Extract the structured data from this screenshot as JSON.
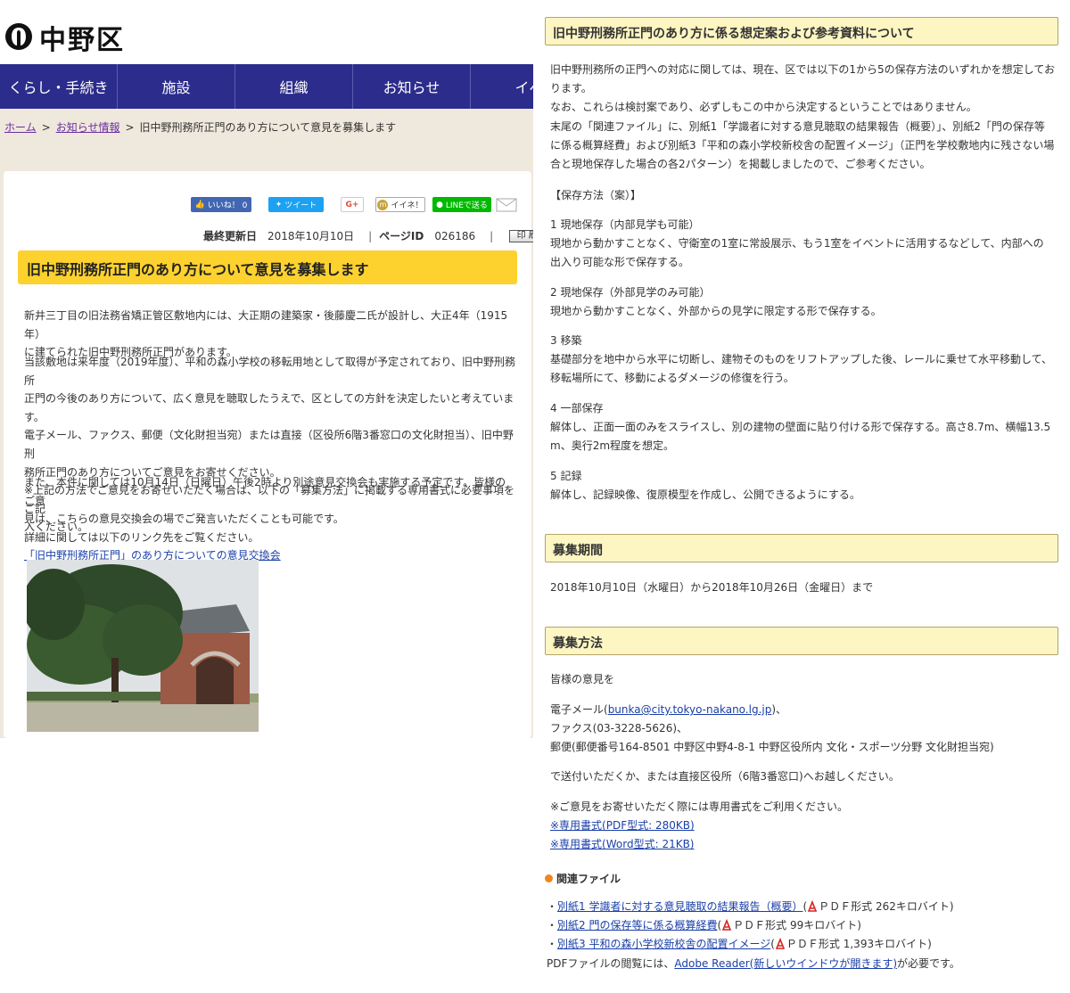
{
  "header": {
    "logo_text": "中野区"
  },
  "nav": [
    "くらし・手続き",
    "施設",
    "組織",
    "お知らせ",
    "イベ"
  ],
  "breadcrumb": {
    "home": "ホーム",
    "sep": ">",
    "news": "お知らせ情報",
    "current": "旧中野刑務所正門のあり方について意見を募集します"
  },
  "share": {
    "like": "いいね！ 0",
    "tweet": "ツイート",
    "gplus": "G+",
    "iine": "イイネ！",
    "line": "LINEで送る"
  },
  "meta": {
    "updated_label": "最終更新日",
    "updated_value": "2018年10月10日",
    "sep": "|",
    "page_id_label": "ページID",
    "page_id_value": "026186",
    "print": "印 刷"
  },
  "article": {
    "title": "旧中野刑務所正門のあり方について意見を募集します",
    "p1": [
      "新井三丁目の旧法務省矯正管区敷地内には、大正期の建築家・後藤慶二氏が設計し、大正4年（1915年）",
      "に建てられた旧中野刑務所正門があります。"
    ],
    "p2": [
      "当該敷地は来年度（2019年度）、平和の森小学校の移転用地として取得が予定されており、旧中野刑務所",
      "正門の今後のあり方について、広く意見を聴取したうえで、区としての方針を決定したいと考えています。",
      "電子メール、ファクス、郵便（文化財担当宛）または直接（区役所6階3番窓口の文化財担当）、旧中野刑",
      "務所正門のあり方についてご意見をお寄せください。",
      "※上記の方法でご意見をお寄せいただく場合は、以下の「募集方法」に掲載する専用書式に必要事項をご記",
      "入ください。"
    ],
    "p3": [
      "また、本件に関しては10月14日（日曜日）午後2時より別途意見交換会も実施する予定です。皆様のご意",
      "見は、こちらの意見交換会の場でご発言いただくことも可能です。",
      "詳細に関しては以下のリンク先をご覧ください。"
    ],
    "link": "「旧中野刑務所正門」のあり方についての意見交換会"
  },
  "right": {
    "h1": "旧中野刑務所正門のあり方に係る想定案および参考資料について",
    "intro": [
      "旧中野刑務所の正門への対応に関しては、現在、区では以下の1から5の保存方法のいずれかを想定してお",
      "ります。",
      "なお、これらは検討案であり、必ずしもこの中から決定するということではありません。",
      "末尾の「関連ファイル」に、別紙1「学識者に対する意見聴取の結果報告（概要）」、別紙2「門の保存等",
      "に係る概算経費」および別紙3「平和の森小学校新校舎の配置イメージ」（正門を学校敷地内に残さない場",
      "合と現地保存した場合の各2パターン）を掲載しましたので、ご参考ください。"
    ],
    "methods_label": "【保存方法（案）】",
    "methods": [
      {
        "title": "1  現地保存（内部見学も可能）",
        "lines": [
          "  現地から動かすことなく、守衛室の1室に常設展示、もう1室をイベントに活用するなどして、内部への",
          "出入り可能な形で保存する。"
        ]
      },
      {
        "title": "2  現地保存（外部見学のみ可能）",
        "lines": [
          "  現地から動かすことなく、外部からの見学に限定する形で保存する。"
        ]
      },
      {
        "title": "3  移築",
        "lines": [
          "  基礎部分を地中から水平に切断し、建物そのものをリフトアップした後、レールに乗せて水平移動して、",
          "移転場所にて、移動によるダメージの修復を行う。"
        ]
      },
      {
        "title": "4  一部保存",
        "lines": [
          "  解体し、正面一面のみをスライスし、別の建物の壁面に貼り付ける形で保存する。高さ8.7m、横幅13.5",
          "m、奥行2m程度を想定。"
        ]
      },
      {
        "title": "5  記録",
        "lines": [
          "  解体し、記録映像、復原模型を作成し、公開できるようにする。"
        ]
      }
    ],
    "h2": "募集期間",
    "period": "2018年10月10日（水曜日）から2018年10月26日（金曜日）まで",
    "h3": "募集方法",
    "opinion_intro": "皆様の意見を",
    "email_prefix": "電子メール(",
    "email": "bunka@city.tokyo-nakano.lg.jp",
    "email_suffix": ")、",
    "fax": "ファクス(03-3228-5626)、",
    "post": "郵便(郵便番号164-8501 中野区中野4-8-1 中野区役所内 文化・スポーツ分野 文化財担当宛)",
    "send": "で送付いただくか、または直接区役所（6階3番窓口)へお越しください。",
    "form_note": "※ご意見をお寄せいただく際には専用書式をご利用ください。",
    "form_pdf": "※専用書式(PDF型式: 280KB)",
    "form_word": "※専用書式(Word型式: 21KB)",
    "related_label": "関連ファイル",
    "files": [
      {
        "bullet": "・",
        "link": "別紙1 学識者に対する意見聴取の結果報告（概要）",
        "pre": "(",
        "info": "ＰＤＦ形式 262キロバイト)"
      },
      {
        "bullet": "・",
        "link": "別紙2 門の保存等に係る概算経費",
        "pre": "(",
        "info": "ＰＤＦ形式 99キロバイト)"
      },
      {
        "bullet": "・",
        "link": "別紙3 平和の森小学校新校舎の配置イメージ",
        "pre": "(",
        "info": "ＰＤＦ形式 1,393キロバイト)"
      }
    ],
    "reader_prefix": "PDFファイルの閲覧には、",
    "reader_link": "Adobe Reader(新しいウインドウが開きます)",
    "reader_suffix": "が必要です。"
  },
  "colors": {
    "nav_bg": "#2c2c8c",
    "title_band": "#fdd22e",
    "section_head_bg": "#fdf6c3",
    "link": "#1a3fa8",
    "crumb_link": "#6a2fa0",
    "related_dot": "#f0861e"
  }
}
